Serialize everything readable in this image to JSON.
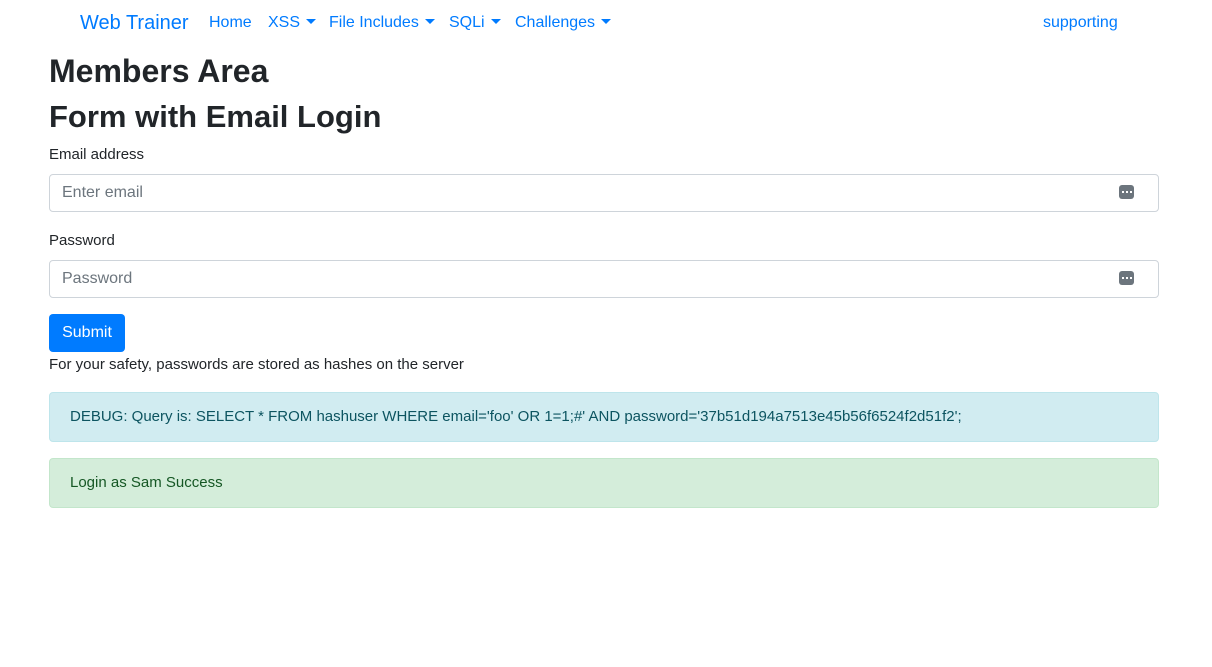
{
  "navbar": {
    "brand": "Web Trainer",
    "items": [
      {
        "label": "Home",
        "dropdown": false
      },
      {
        "label": "XSS",
        "dropdown": true
      },
      {
        "label": "File Includes",
        "dropdown": true
      },
      {
        "label": "SQLi",
        "dropdown": true
      },
      {
        "label": "Challenges",
        "dropdown": true
      }
    ],
    "right_label": "supporting"
  },
  "page": {
    "title": "Members Area",
    "subtitle": "Form with Email Login"
  },
  "form": {
    "email_label": "Email address",
    "email_placeholder": "Enter email",
    "email_value": "",
    "password_label": "Password",
    "password_placeholder": "Password",
    "password_value": "",
    "submit_label": "Submit",
    "note": "For your safety, passwords are stored as hashes on the server"
  },
  "alerts": {
    "debug": "DEBUG: Query is: SELECT * FROM hashuser WHERE email='foo' OR 1=1;#' AND password='37b51d194a7513e45b56f6524f2d51f2';",
    "success": "Login as Sam Success"
  },
  "colors": {
    "primary": "#007bff",
    "info_bg": "#d1ecf1",
    "success_bg": "#d4edda"
  }
}
